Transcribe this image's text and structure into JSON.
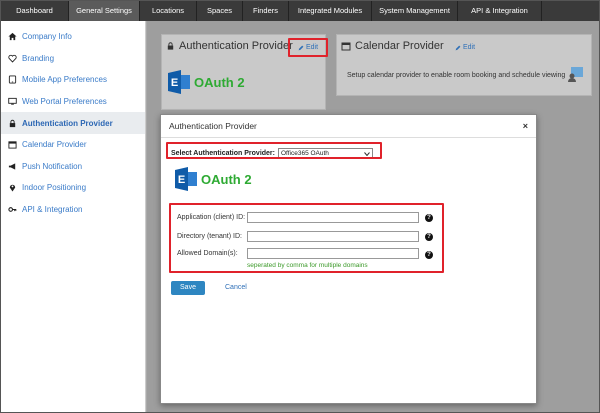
{
  "topnav": {
    "tabs": [
      {
        "label": "Dashboard"
      },
      {
        "label": "General Settings"
      },
      {
        "label": "Locations"
      },
      {
        "label": "Spaces"
      },
      {
        "label": "Finders"
      },
      {
        "label": "Integrated Modules"
      },
      {
        "label": "System Management"
      },
      {
        "label": "API & Integration"
      }
    ],
    "active_index": 1
  },
  "sidebar": {
    "items": [
      {
        "label": "Company Info",
        "icon": "home-icon"
      },
      {
        "label": "Branding",
        "icon": "heart-icon"
      },
      {
        "label": "Mobile App Preferences",
        "icon": "tablet-icon"
      },
      {
        "label": "Web Portal Preferences",
        "icon": "monitor-icon"
      },
      {
        "label": "Authentication Provider",
        "icon": "lock-icon"
      },
      {
        "label": "Calendar Provider",
        "icon": "calendar-icon"
      },
      {
        "label": "Push Notification",
        "icon": "megaphone-icon"
      },
      {
        "label": "Indoor Positioning",
        "icon": "map-marker-icon"
      },
      {
        "label": "API & Integration",
        "icon": "key-icon"
      }
    ],
    "active_index": 4
  },
  "cards": {
    "auth": {
      "title": "Authentication Provider",
      "edit_label": "Edit",
      "logo_text": "OAuth 2"
    },
    "calendar": {
      "title": "Calendar Provider",
      "edit_label": "Edit",
      "description": "Setup calendar provider to enable room booking and schedule viewing"
    }
  },
  "modal": {
    "title": "Authentication Provider",
    "close_label": "×",
    "provider_label": "Select Authentication Provider:",
    "provider_value": "Office365 OAuth",
    "logo_text": "OAuth 2",
    "fields": [
      {
        "label": "Application (client) ID:",
        "value": ""
      },
      {
        "label": "Directory (tenant) ID:",
        "value": ""
      },
      {
        "label": "Allowed Domain(s):",
        "value": ""
      }
    ],
    "help_glyph": "?",
    "hint": "seperated by comma for multiple domains",
    "save_label": "Save",
    "cancel_label": "Cancel"
  },
  "colors": {
    "accent": "#2e86c1",
    "highlight": "#e0222b",
    "oauth_green": "#2eaa33"
  }
}
